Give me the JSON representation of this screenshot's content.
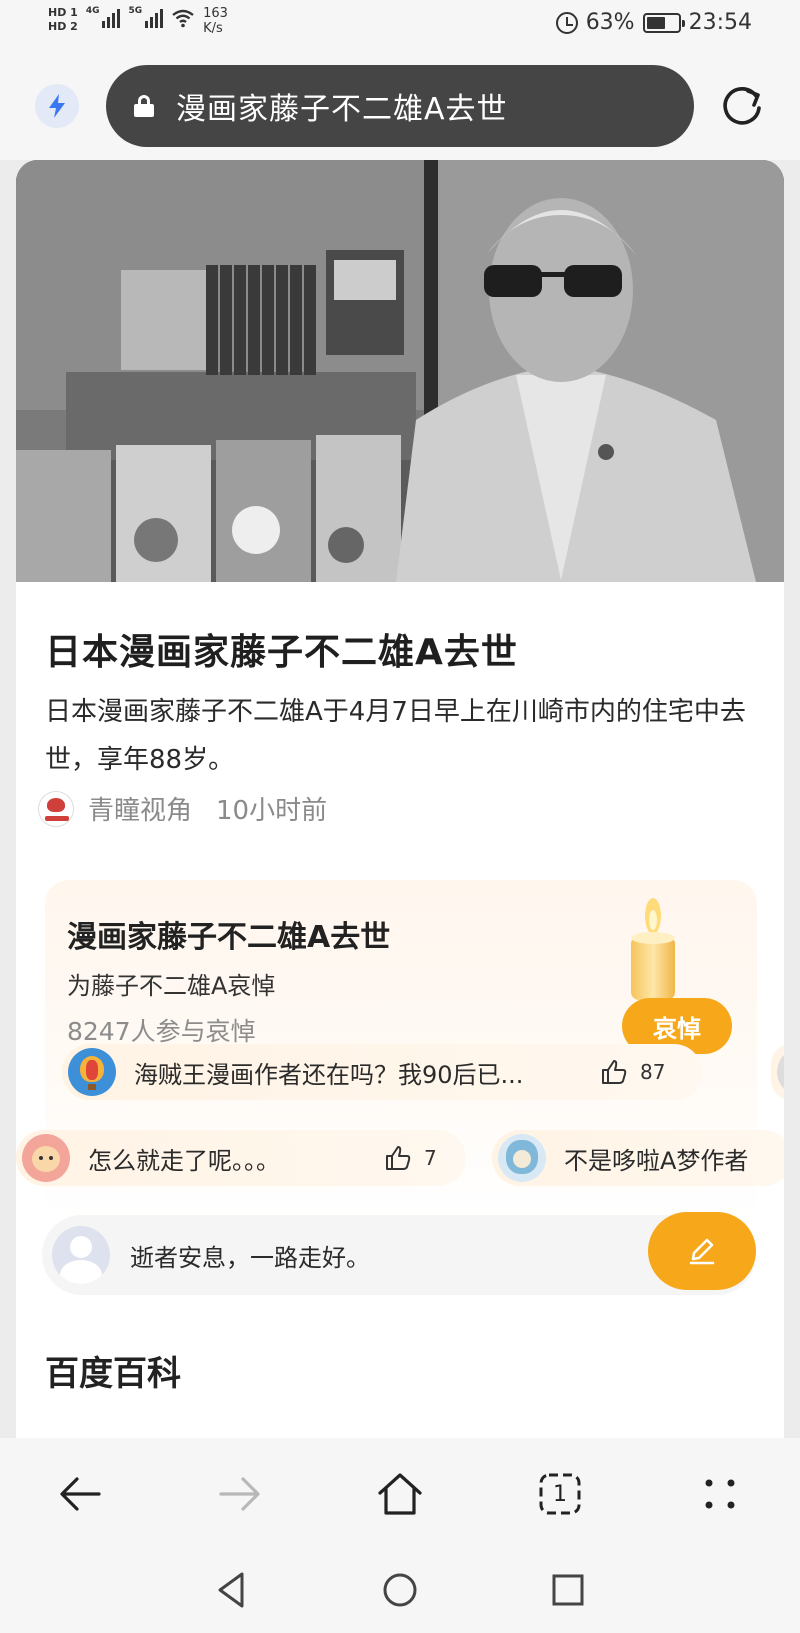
{
  "status_bar": {
    "hd1": "HD 1",
    "hd2": "HD 2",
    "net1": "4G",
    "net2": "5G",
    "speed_value": "163",
    "speed_unit": "K/s",
    "battery": "63%",
    "time": "23:54"
  },
  "address_bar": {
    "url_text": "漫画家藤子不二雄A去世",
    "icons": [
      "bolt-icon",
      "lock-icon",
      "refresh-icon"
    ]
  },
  "article": {
    "title": "日本漫画家藤子不二雄A去世",
    "summary": "日本漫画家藤子不二雄A于4月7日早上在川崎市内的住宅中去世，享年88岁。",
    "source": "青瞳视角",
    "time": "10小时前"
  },
  "mourning": {
    "title": "漫画家藤子不二雄A去世",
    "subtitle": "为藤子不二雄A哀悼",
    "count": "8247人参与哀悼",
    "button": "哀悼"
  },
  "comments": [
    {
      "text": "海贼王漫画作者还在吗？我90后已...",
      "likes": "87"
    },
    {
      "text": "怎么就走了呢。。。",
      "likes": "7"
    },
    {
      "text": "不是哆啦A梦作者"
    }
  ],
  "comment_input": {
    "placeholder": "逝者安息，一路走好。"
  },
  "section": {
    "baike": "百度百科"
  },
  "bottom_nav": {
    "tab_count": "1",
    "icons": [
      "back-arrow-icon",
      "forward-arrow-icon",
      "home-icon",
      "tabs-icon",
      "menu-dots-icon"
    ]
  },
  "system_nav": {
    "icons": [
      "triangle-back-icon",
      "circle-home-icon",
      "square-recents-icon"
    ]
  },
  "colors": {
    "accent": "#f6a81a",
    "url_bar": "#454545",
    "link_blue": "#3a78f2"
  }
}
